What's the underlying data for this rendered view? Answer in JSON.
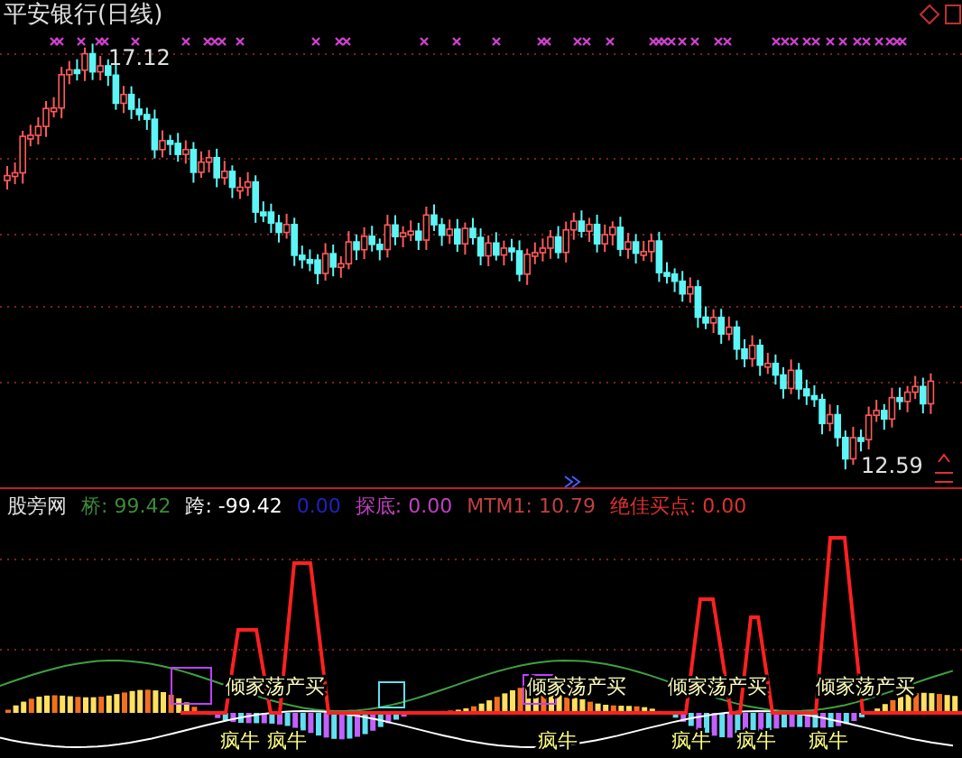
{
  "chart": {
    "title": "平安银行(日线)",
    "high_label": "17.12",
    "low_label": "12.59"
  },
  "indicator": {
    "name": "股旁网",
    "readouts": [
      {
        "label": "桥:",
        "value": "99.42",
        "color": "#3c8c3c"
      },
      {
        "label": "跨:",
        "value": "-99.42",
        "color": "#ffffff"
      },
      {
        "value": "0.00",
        "color": "#2020c0"
      },
      {
        "label": "探底:",
        "value": "0.00",
        "color": "#c040c0"
      },
      {
        "label": "MTM1:",
        "value": "10.79",
        "color": "#c04040"
      },
      {
        "label": "绝佳买点:",
        "value": "0.00",
        "color": "#e03030"
      }
    ],
    "signals": [
      {
        "text": "倾家荡产买"
      },
      {
        "text": "倾家荡产买"
      },
      {
        "text": "倾家荡产买"
      },
      {
        "text": "倾家荡产买"
      }
    ],
    "bull_labels": [
      {
        "text": "疯牛"
      },
      {
        "text": "疯牛"
      },
      {
        "text": "疯牛"
      },
      {
        "text": "疯牛"
      },
      {
        "text": "疯牛"
      },
      {
        "text": "疯牛"
      }
    ]
  }
}
